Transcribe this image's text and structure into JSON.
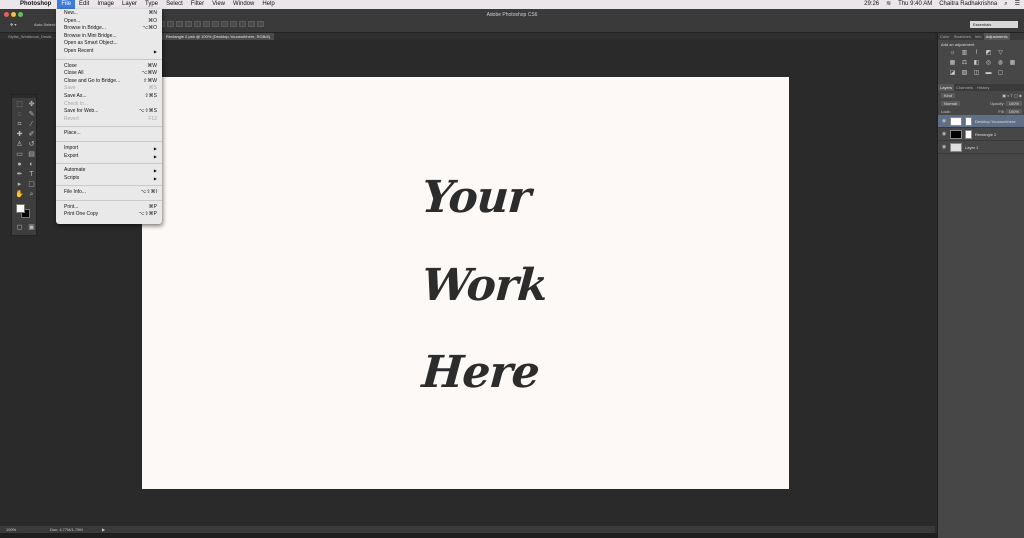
{
  "menubar": {
    "app": "Photoshop",
    "items": [
      "File",
      "Edit",
      "Image",
      "Layer",
      "Type",
      "Select",
      "Filter",
      "View",
      "Window",
      "Help"
    ],
    "clock": "Thu 9:40 AM",
    "user": "Chaitra Radhakrishna",
    "battery": "29:26"
  },
  "app": {
    "title": "Adobe Photoshop CS6",
    "auto_select": "Auto-Select:",
    "workspace": "Essentials"
  },
  "tabs": [
    "Stylist_Workbook_Deskt...",
    "Rectangle 2.psb @ 100% (Desktop-Yourworkhere, RGB/8)"
  ],
  "file_menu": {
    "groups": [
      [
        {
          "label": "New...",
          "shortcut": "⌘N"
        },
        {
          "label": "Open...",
          "shortcut": "⌘O"
        },
        {
          "label": "Browse in Bridge...",
          "shortcut": "⌥⌘O"
        },
        {
          "label": "Browse in Mini Bridge...",
          "shortcut": ""
        },
        {
          "label": "Open as Smart Object...",
          "shortcut": ""
        },
        {
          "label": "Open Recent",
          "shortcut": "",
          "submenu": true
        }
      ],
      [
        {
          "label": "Close",
          "shortcut": "⌘W"
        },
        {
          "label": "Close All",
          "shortcut": "⌥⌘W"
        },
        {
          "label": "Close and Go to Bridge...",
          "shortcut": "⇧⌘W"
        },
        {
          "label": "Save",
          "shortcut": "⌘S",
          "disabled": true
        },
        {
          "label": "Save As...",
          "shortcut": "⇧⌘S"
        },
        {
          "label": "Check In...",
          "shortcut": "",
          "disabled": true
        },
        {
          "label": "Save for Web...",
          "shortcut": "⌥⇧⌘S"
        },
        {
          "label": "Revert",
          "shortcut": "F12",
          "disabled": true
        }
      ],
      [
        {
          "label": "Place...",
          "shortcut": ""
        }
      ],
      [
        {
          "label": "Import",
          "shortcut": "",
          "submenu": true
        },
        {
          "label": "Export",
          "shortcut": "",
          "submenu": true
        }
      ],
      [
        {
          "label": "Automate",
          "shortcut": "",
          "submenu": true
        },
        {
          "label": "Scripts",
          "shortcut": "",
          "submenu": true
        }
      ],
      [
        {
          "label": "File Info...",
          "shortcut": "⌥⇧⌘I"
        }
      ],
      [
        {
          "label": "Print...",
          "shortcut": "⌘P"
        },
        {
          "label": "Print One Copy",
          "shortcut": "⌥⇧⌘P"
        }
      ]
    ]
  },
  "canvas": {
    "line1": "Your",
    "line2": "Work",
    "line3": "Here"
  },
  "status": {
    "zoom": "100%",
    "doc": "Doc: 4.77M/1.79M"
  },
  "panels": {
    "top_tabs": [
      "Color",
      "Swatches",
      "Info",
      "Adjustments"
    ],
    "adjust_title": "Add an adjustment",
    "layer_tabs": [
      "Layers",
      "Channels",
      "History"
    ],
    "kind": "Kind",
    "blend": "Normal",
    "opacity_label": "Opacity:",
    "opacity": "100%",
    "lock_label": "Lock:",
    "fill_label": "Fill:",
    "fill": "100%",
    "layers": [
      {
        "name": "Desktop-Yourworkhere",
        "selected": true
      },
      {
        "name": "Rectangle 2",
        "selected": false
      },
      {
        "name": "Layer 1",
        "selected": false
      }
    ]
  }
}
